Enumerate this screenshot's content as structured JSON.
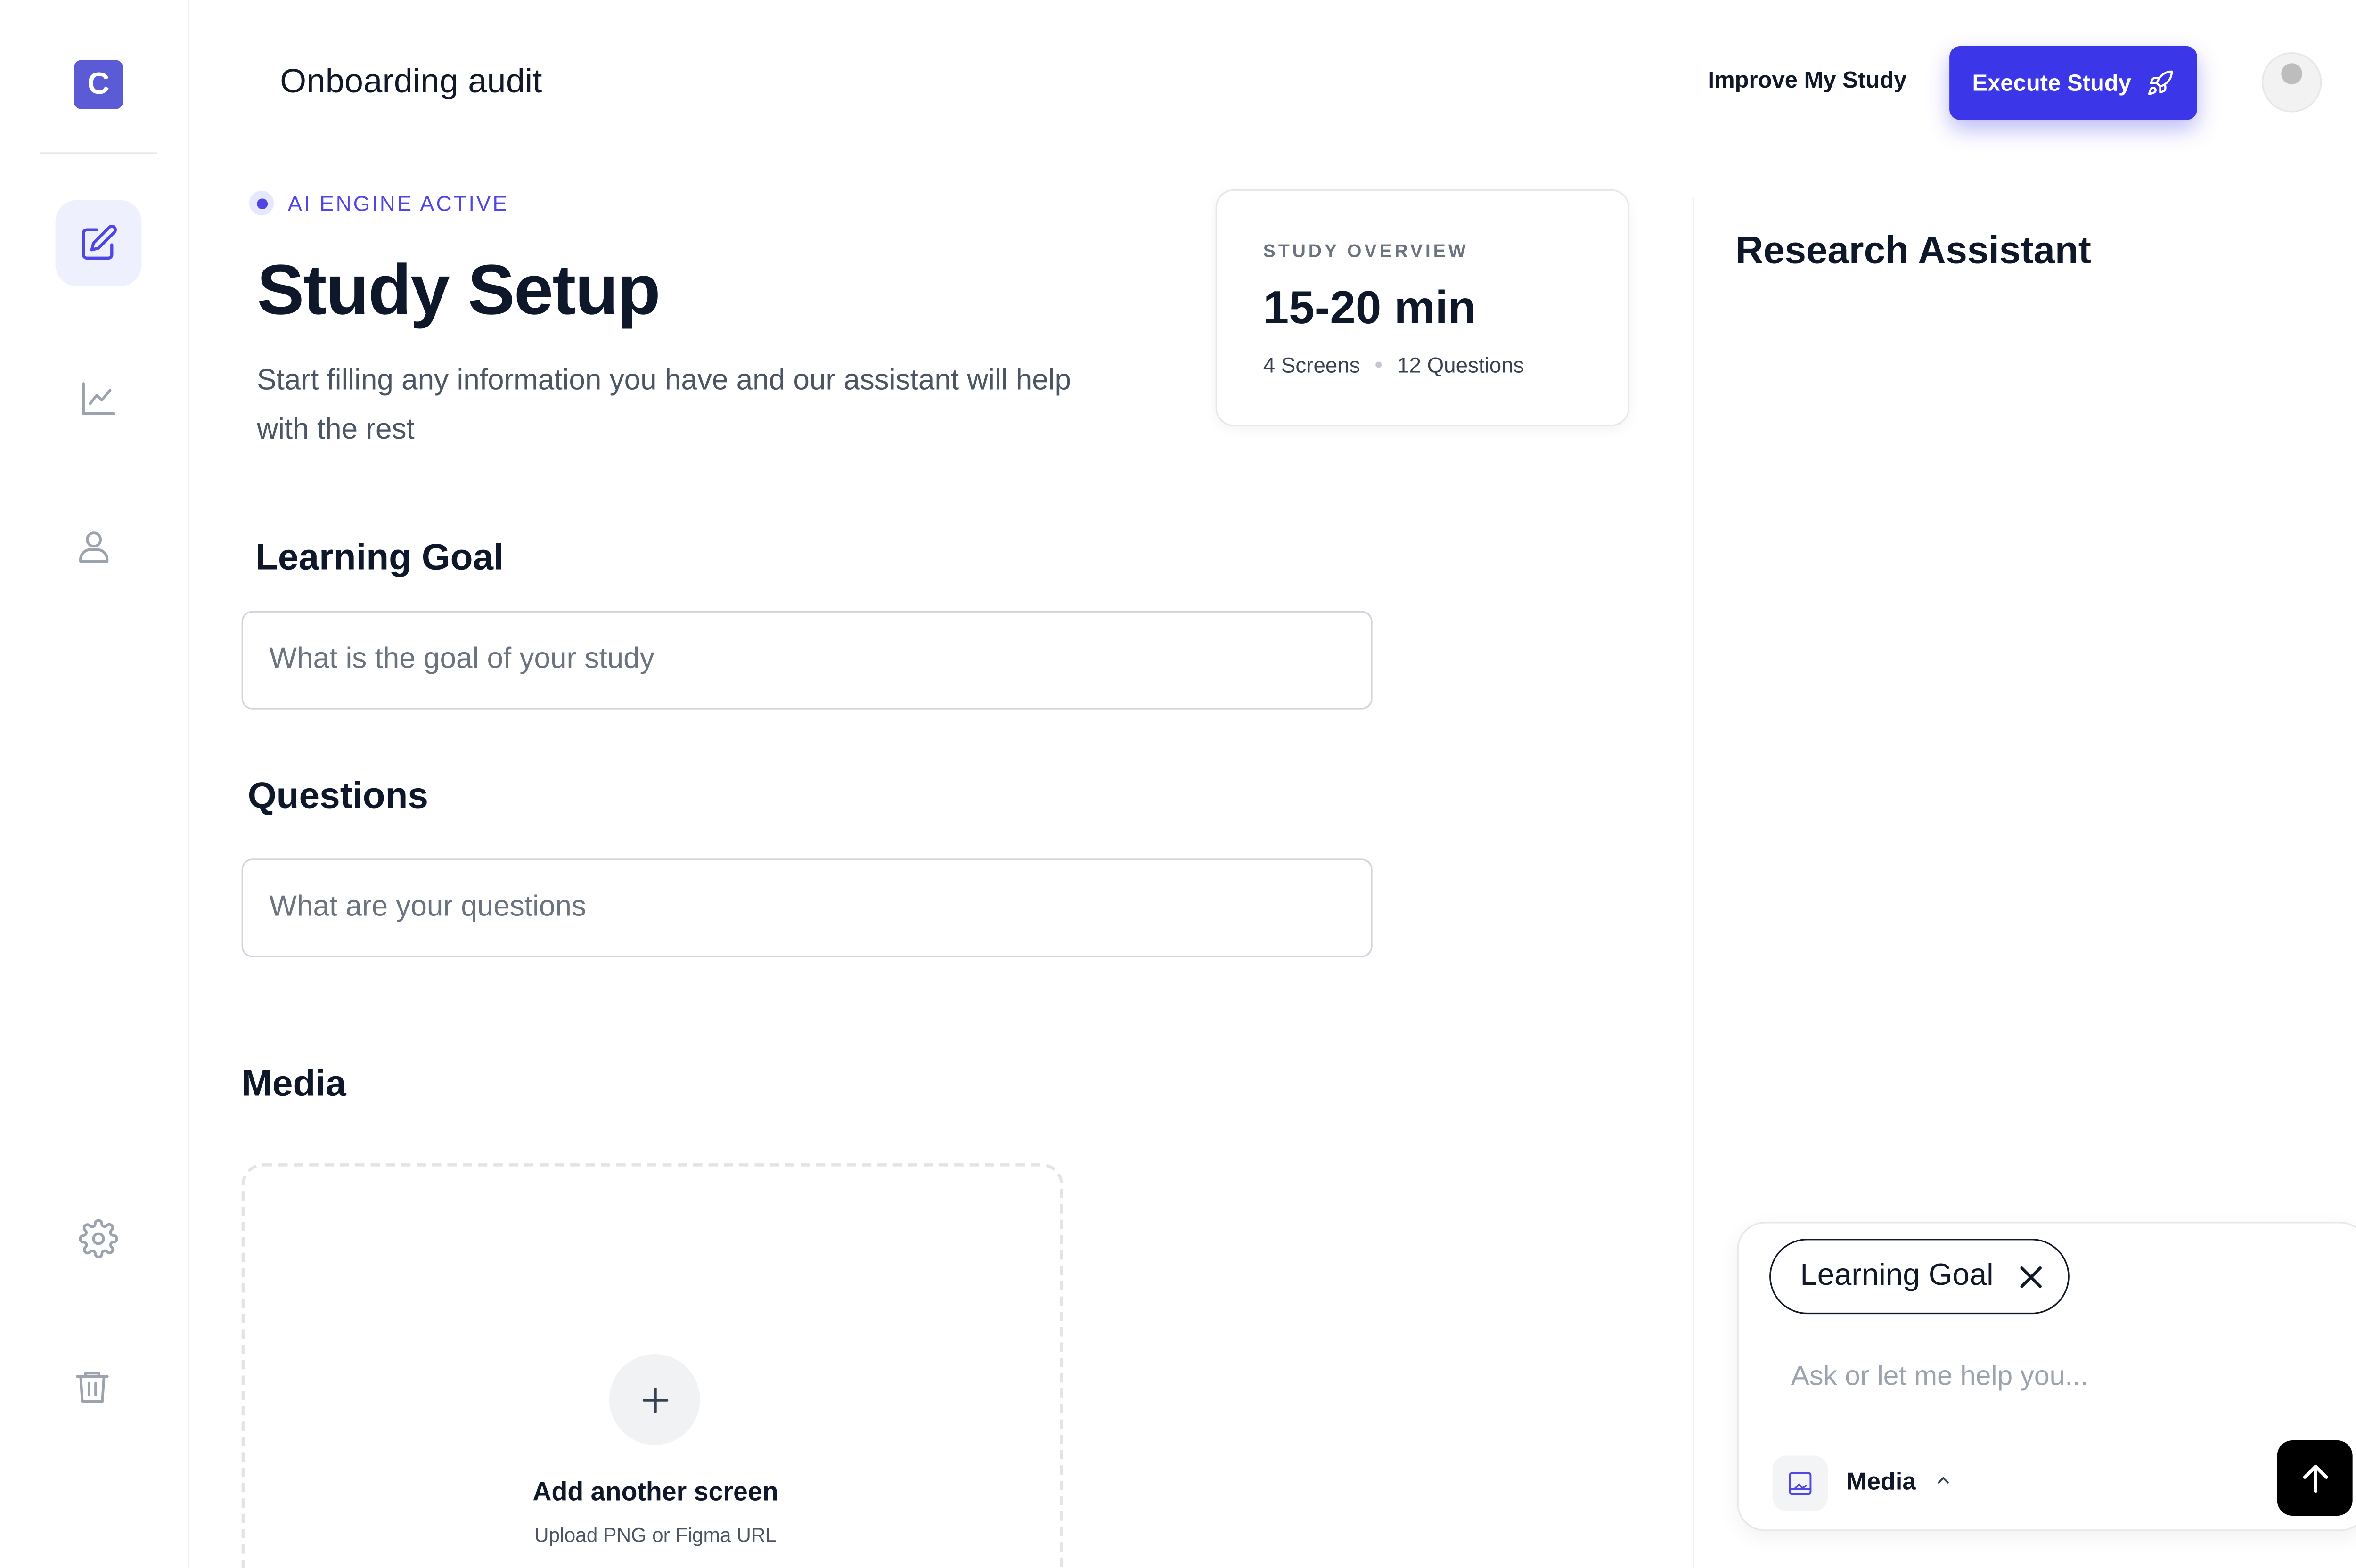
{
  "app": {
    "logo_letter": "C",
    "brand_color": "#5b5bd6",
    "accent_color": "#3b36e8"
  },
  "sidebar": {
    "items": [
      {
        "name": "edit-icon",
        "active": true
      },
      {
        "name": "analytics-icon",
        "active": false
      },
      {
        "name": "user-icon",
        "active": false
      },
      {
        "name": "gear-icon",
        "active": false
      },
      {
        "name": "trash-icon",
        "active": false
      }
    ]
  },
  "header": {
    "title": "Onboarding audit",
    "improve_label": "Improve My Study",
    "execute_label": "Execute Study"
  },
  "main": {
    "status_label": "AI ENGINE ACTIVE",
    "title": "Study Setup",
    "description": "Start filling any information you have and our assistant will help with the rest",
    "overview": {
      "label": "STUDY OVERVIEW",
      "duration": "15-20 min",
      "screens": "4 Screens",
      "questions": "12 Questions"
    },
    "learning_goal": {
      "title": "Learning Goal",
      "value": "",
      "placeholder": "What is the goal of your study"
    },
    "questions": {
      "title": "Questions",
      "value": "",
      "placeholder": "What are your questions"
    },
    "media": {
      "title": "Media",
      "upload_title": "Add another screen",
      "upload_subtitle": "Upload PNG or Figma URL"
    }
  },
  "assistant": {
    "title": "Research Assistant",
    "chip_label": "Learning Goal",
    "input_placeholder": "Ask or let me help you...",
    "input_value": "",
    "media_label": "Media"
  }
}
